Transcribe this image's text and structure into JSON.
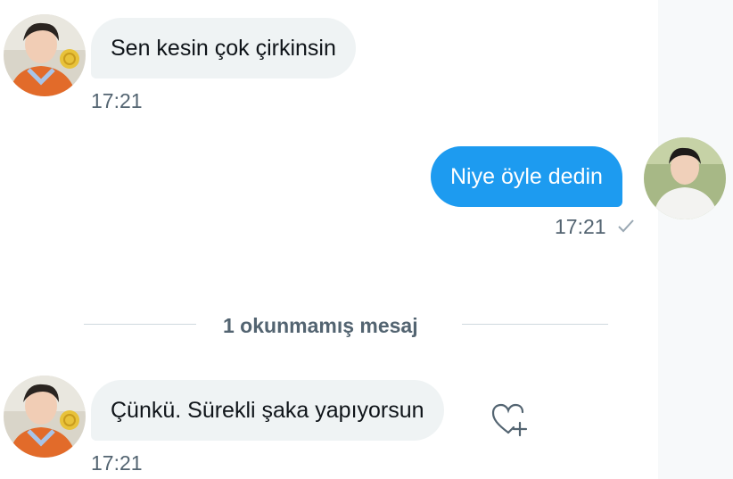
{
  "messages": [
    {
      "text": "Sen kesin çok çirkinsin",
      "time": "17:21",
      "side": "received"
    },
    {
      "text": "Niye öyle dedin",
      "time": "17:21",
      "side": "sent"
    },
    {
      "text": "Çünkü. Sürekli şaka yapıyorsun",
      "time": "17:21",
      "side": "received"
    }
  ],
  "unread_divider": "1 okunmamış mesaj",
  "icons": {
    "read_receipt": "checkmark-icon",
    "react": "heart-plus-icon"
  },
  "colors": {
    "sent_bubble": "#1d9bf0",
    "received_bubble": "#eff3f4",
    "muted_text": "#536471"
  }
}
